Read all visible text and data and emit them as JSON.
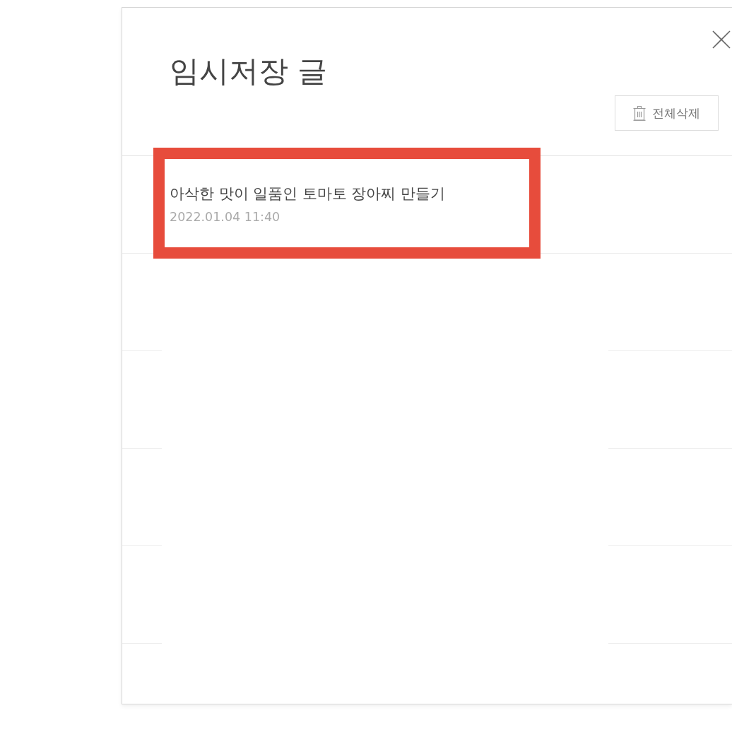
{
  "dialog": {
    "title": "임시저장 글",
    "delete_all_button": {
      "label": "전체삭제"
    }
  },
  "drafts": [
    {
      "title": "아삭한 맛이 일품인 토마토 장아찌 만들기",
      "date": "2022.01.04 11:40",
      "highlighted": true
    }
  ]
}
